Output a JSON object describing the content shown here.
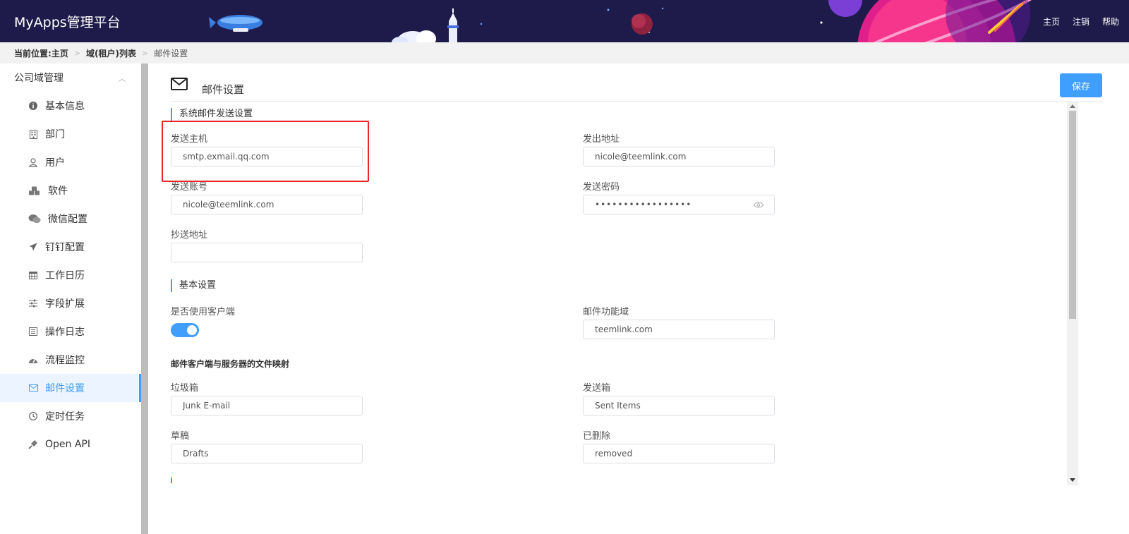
{
  "app": {
    "title": "MyApps管理平台"
  },
  "top_nav": [
    {
      "label": "主页"
    },
    {
      "label": "注销"
    },
    {
      "label": "帮助"
    }
  ],
  "breadcrumb": {
    "prefix": "当前位置:",
    "items": [
      {
        "label": "主页"
      },
      {
        "label": "域(租户)列表"
      },
      {
        "label": "邮件设置"
      }
    ]
  },
  "sidebar": {
    "group_label": "公司域管理",
    "items": [
      {
        "label": "基本信息",
        "icon": "info-icon"
      },
      {
        "label": "部门",
        "icon": "building-icon"
      },
      {
        "label": "用户",
        "icon": "user-icon"
      },
      {
        "label": "软件",
        "icon": "cubes-icon"
      },
      {
        "label": "微信配置",
        "icon": "wechat-icon"
      },
      {
        "label": "钉钉配置",
        "icon": "plane-icon"
      },
      {
        "label": "工作日历",
        "icon": "calendar-icon"
      },
      {
        "label": "字段扩展",
        "icon": "sliders-icon"
      },
      {
        "label": "操作日志",
        "icon": "log-icon"
      },
      {
        "label": "流程监控",
        "icon": "dashboard-icon"
      },
      {
        "label": "邮件设置",
        "icon": "mail-icon",
        "active": true
      },
      {
        "label": "定时任务",
        "icon": "clock-icon"
      },
      {
        "label": "Open API",
        "icon": "plug-icon"
      }
    ]
  },
  "page": {
    "title": "邮件设置",
    "save_label": "保存"
  },
  "form": {
    "section_send": "系统邮件发送设置",
    "send_host": {
      "label": "发送主机",
      "value": "smtp.exmail.qq.com"
    },
    "from_address": {
      "label": "发出地址",
      "value": "nicole@teemlink.com"
    },
    "send_account": {
      "label": "发送账号",
      "value": "nicole@teemlink.com"
    },
    "send_password": {
      "label": "发送密码",
      "value": "•••••••••••••••••"
    },
    "cc_address": {
      "label": "抄送地址",
      "value": ""
    },
    "section_basic": "基本设置",
    "use_client": {
      "label": "是否使用客户端",
      "enabled": true
    },
    "mail_domain": {
      "label": "邮件功能域",
      "value": "teemlink.com"
    },
    "mapping_title": "邮件客户端与服务器的文件映射",
    "junk": {
      "label": "垃圾箱",
      "value": "Junk E-mail"
    },
    "sent": {
      "label": "发送箱",
      "value": "Sent Items"
    },
    "drafts": {
      "label": "草稿",
      "value": "Drafts"
    },
    "deleted": {
      "label": "已删除",
      "value": "removed"
    }
  },
  "colors": {
    "header_bg": "#1e1a4a",
    "accent": "#409eff",
    "highlight": "#e8262a"
  }
}
